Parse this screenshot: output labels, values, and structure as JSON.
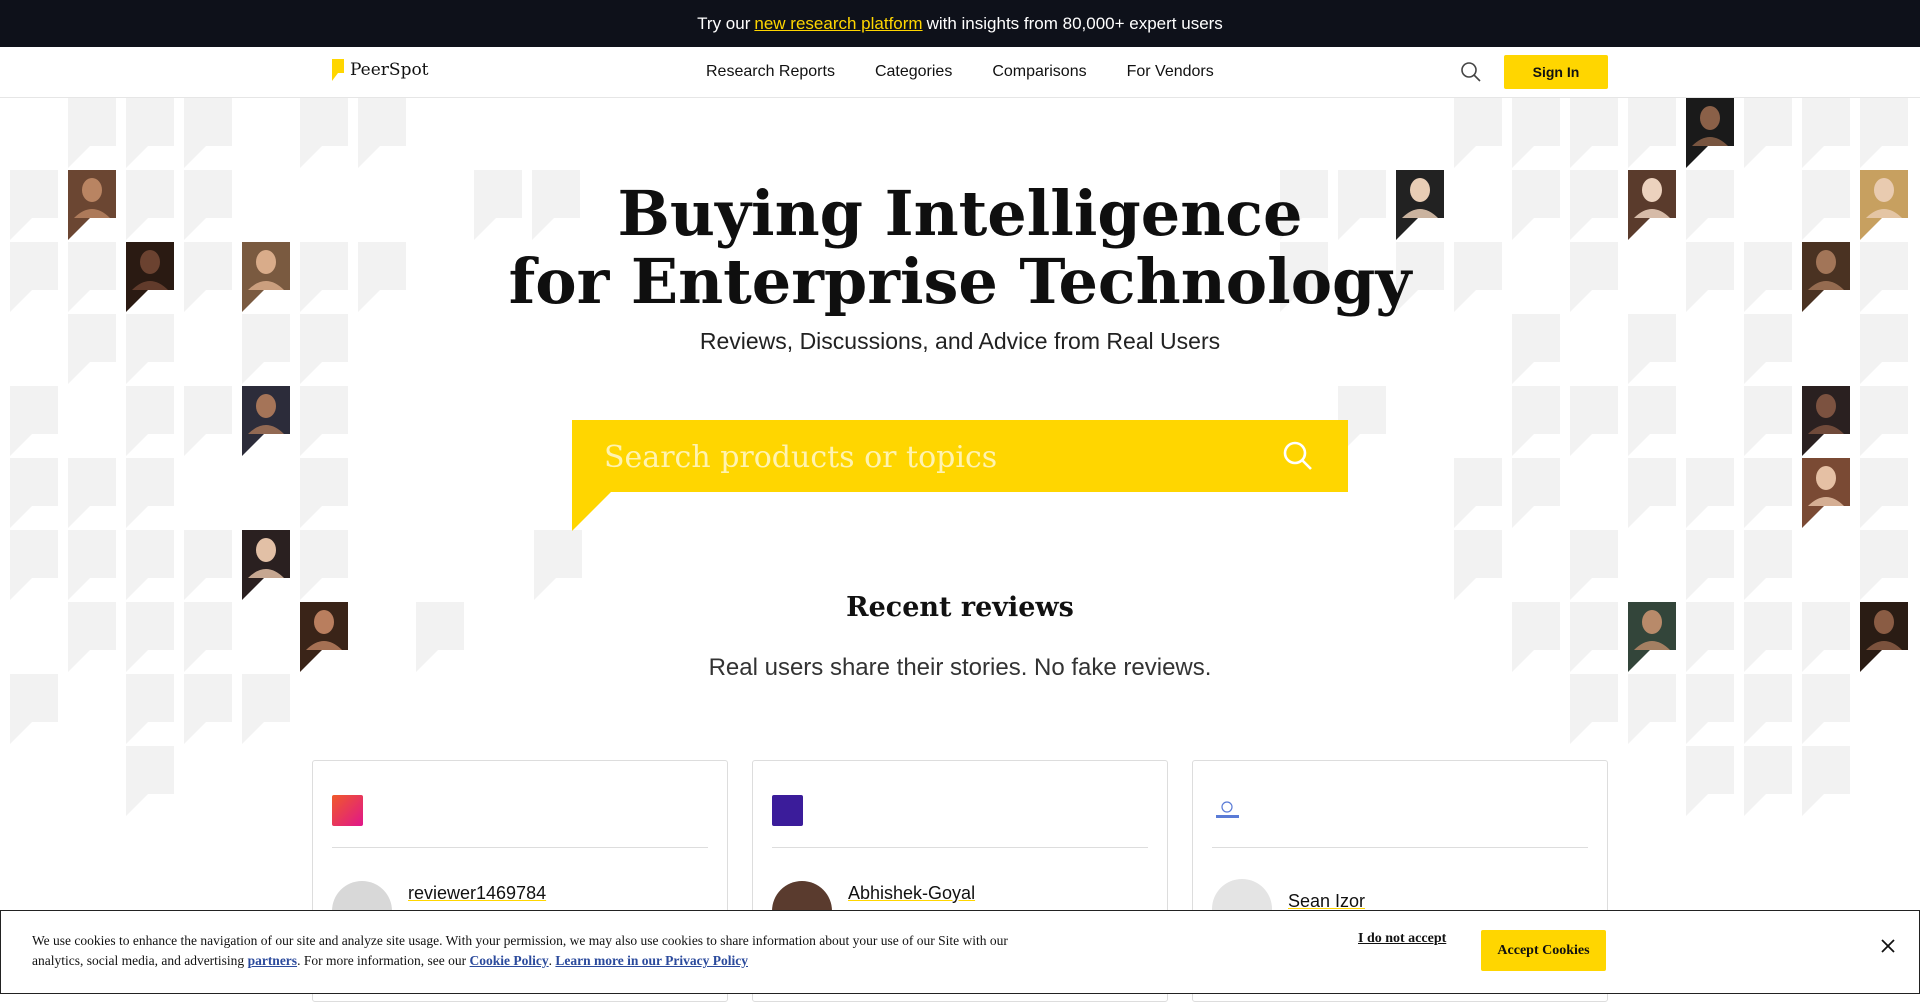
{
  "promo": {
    "prefix": "Try our",
    "link": "new research platform",
    "suffix": "with insights from 80,000+ expert users"
  },
  "nav": {
    "logo": "PeerSpot",
    "links": [
      "Research Reports",
      "Categories",
      "Comparisons",
      "For Vendors"
    ],
    "signin": "Sign In",
    "search_icon": "search-icon"
  },
  "hero": {
    "title_line1": "Buying Intelligence",
    "title_line2": "for Enterprise Technology",
    "subtitle": "Reviews, Discussions, and Advice from Real Users",
    "search_placeholder": "Search products or topics"
  },
  "recent": {
    "title": "Recent reviews",
    "subtitle": "Real users share their stories. No fake reviews."
  },
  "reviews": [
    {
      "reviewer": "reviewer1469784",
      "logo_color": "#f0592a"
    },
    {
      "reviewer": "Abhishek-Goyal",
      "logo_color": "#3b1c9a"
    },
    {
      "reviewer": "Sean Izor",
      "logo_color": "#5a7bd6"
    }
  ],
  "cookie": {
    "line1": "We use cookies to enhance the navigation of our site and analyze site usage. With your permission, we may also use cookies to share information about your use of our Site with our",
    "line2_prefix": "analytics, social media, and advertising",
    "partners": "partners",
    "line2_mid": ". For more information, see our",
    "cookie_policy": "Cookie Policy",
    "sep": ".",
    "privacy": "Learn more in our Privacy Policy",
    "reject": "I do not accept",
    "accept": "Accept Cookies"
  },
  "colors": {
    "accent": "#ffd600",
    "promo_bg": "#0e111a",
    "bubble": "#f2f2f2"
  }
}
